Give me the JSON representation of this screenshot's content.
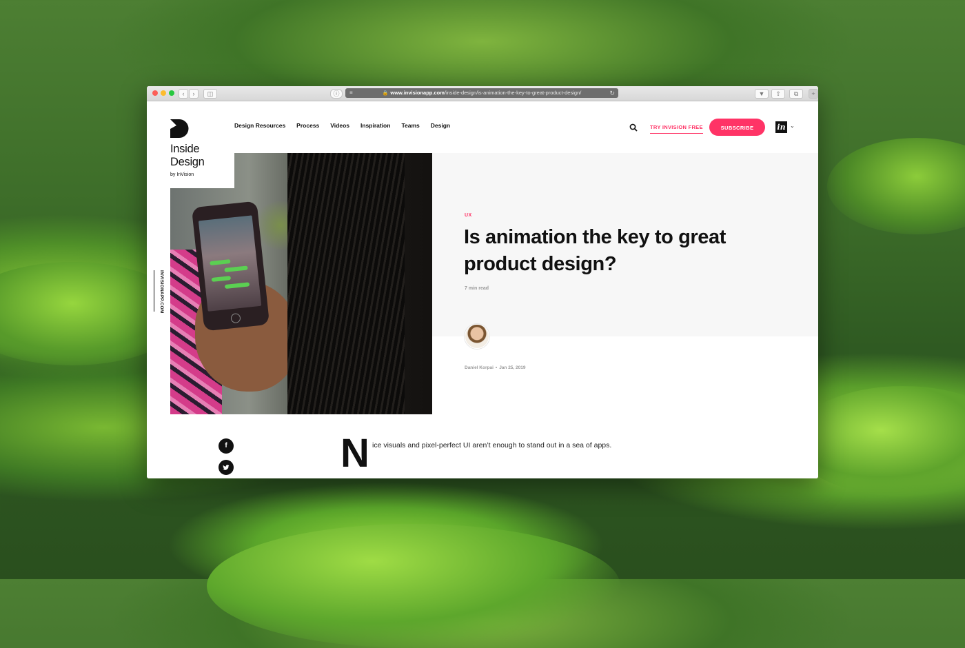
{
  "browser": {
    "url_domain": "www.invisionapp.com",
    "url_path": "/inside-design/is-animation-the-key-to-great-product-design/"
  },
  "site": {
    "logo_title_line1": "Inside",
    "logo_title_line2": "Design",
    "logo_by": "by InVision",
    "side_label": "INVISIONAPP.COM"
  },
  "nav": {
    "items": [
      "Design Resources",
      "Process",
      "Videos",
      "Inspiration",
      "Teams",
      "Design"
    ],
    "try_label": "TRY INVISION FREE",
    "subscribe_label": "SUBSCRIBE",
    "invision_mark": "in"
  },
  "article": {
    "category": "UX",
    "title": "Is animation the key to great product design?",
    "read_time": "7 min read",
    "author": "Daniel Korpai",
    "date": "Jan 25, 2019",
    "dropcap": "N",
    "intro": "ice visuals and pixel-perfect UI aren’t enough to stand out in a sea of apps."
  },
  "colors": {
    "accent": "#ff3366",
    "text": "#111111",
    "muted": "#999999",
    "panel": "#f7f7f7"
  },
  "icons": {
    "search": "search-icon",
    "facebook": "facebook-icon",
    "twitter": "twitter-icon",
    "lock": "lock-icon",
    "reload": "reload-icon"
  }
}
